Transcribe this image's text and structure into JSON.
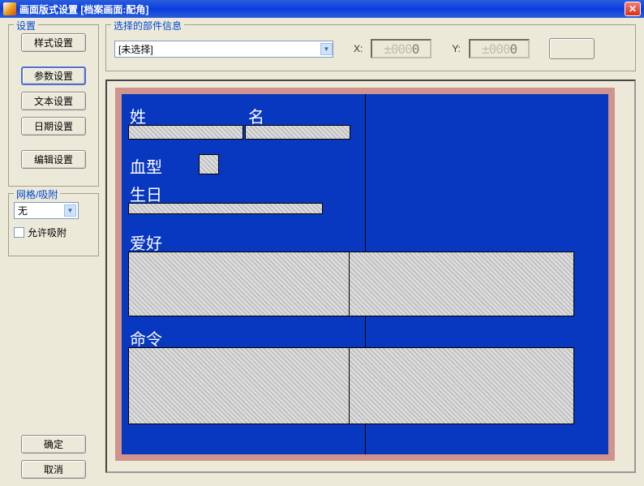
{
  "titlebar": {
    "text": "画面版式设置  [档案画面:配角]"
  },
  "left": {
    "settings_legend": "设置",
    "btn_style": "样式设置",
    "btn_param": "参数设置",
    "btn_text": "文本设置",
    "btn_date": "日期设置",
    "btn_edit": "编辑设置",
    "grid_legend": "网格/吸附",
    "grid_value": "无",
    "snap_label": "允许吸附",
    "btn_ok": "确定",
    "btn_cancel": "取消"
  },
  "info": {
    "legend": "选择的部件信息",
    "combo_value": "[未选择]",
    "x_label": "X:",
    "y_label": "Y:",
    "x_value": "±0000",
    "y_value": "±0000"
  },
  "preview": {
    "surname": "姓",
    "name": "名",
    "blood": "血型",
    "birthday": "生日",
    "hobby": "爱好",
    "command": "命令"
  }
}
